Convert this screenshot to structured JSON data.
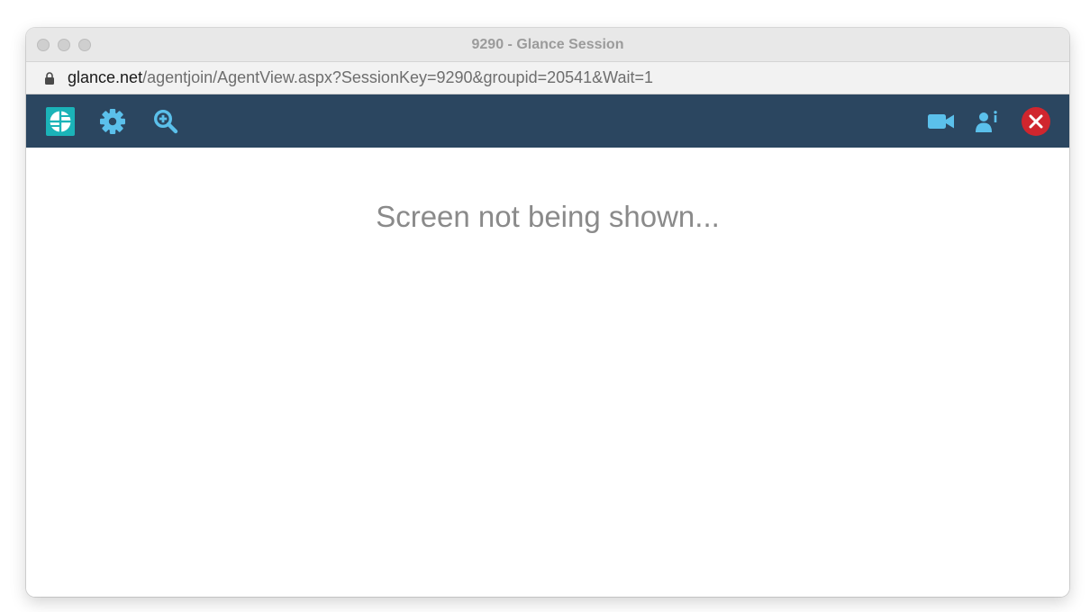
{
  "window": {
    "title": "9290 - Glance Session"
  },
  "address_bar": {
    "domain": "glance.net",
    "path": "/agentjoin/AgentView.aspx?SessionKey=9290&groupid=20541&Wait=1"
  },
  "toolbar": {
    "background": "#2b4660",
    "accent": "#5bc0eb",
    "left_icons": [
      "glance-logo-icon",
      "gear-icon",
      "zoom-in-icon"
    ],
    "right_icons": [
      "video-camera-icon",
      "person-info-icon",
      "close-session-icon"
    ],
    "close_color": "#d0262e"
  },
  "main": {
    "status_text": "Screen not being shown..."
  }
}
